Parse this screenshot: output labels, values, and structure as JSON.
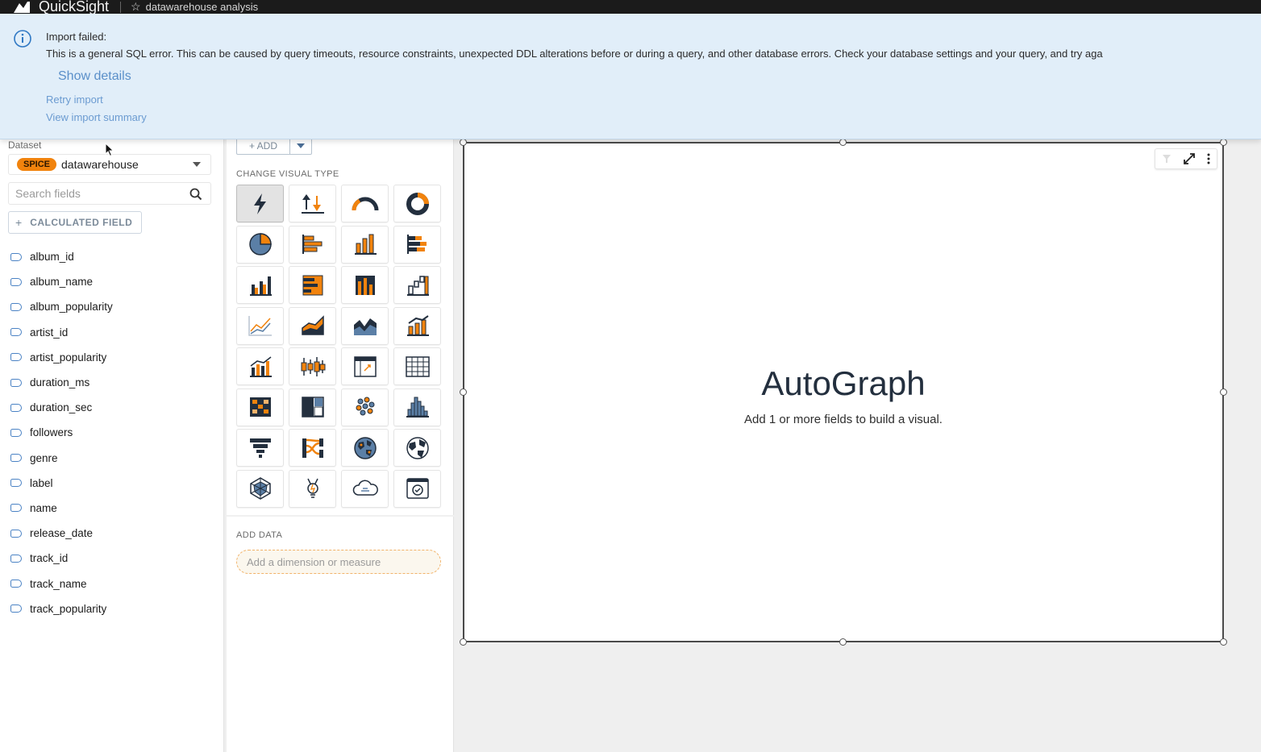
{
  "topbar": {
    "app_title": "QuickSight",
    "analysis_name": "datawarehouse analysis"
  },
  "banner": {
    "title": "Import failed:",
    "message": "This is a general SQL error. This can be caused by query timeouts, resource constraints, unexpected DDL alterations before or during a query, and other database errors. Check your database settings and your query, and try aga",
    "show_details": "Show details",
    "retry_import": "Retry import",
    "view_import_summary": "View import summary"
  },
  "dataset": {
    "label": "Dataset",
    "badge": "SPICE",
    "name": "datawarehouse"
  },
  "search": {
    "placeholder": "Search fields"
  },
  "calculated_field": {
    "label": "CALCULATED FIELD"
  },
  "fields": [
    "album_id",
    "album_name",
    "album_popularity",
    "artist_id",
    "artist_popularity",
    "duration_ms",
    "duration_sec",
    "followers",
    "genre",
    "label",
    "name",
    "release_date",
    "track_id",
    "track_name",
    "track_popularity"
  ],
  "visual_panel": {
    "add_label": "+ ADD",
    "change_visual_type_label": "CHANGE VISUAL TYPE",
    "add_data_label": "ADD DATA",
    "drop_placeholder": "Add a dimension or measure"
  },
  "visual": {
    "title": "AutoGraph",
    "subtitle": "Add 1 or more fields to build a visual."
  },
  "colors": {
    "accent_orange": "#f1830d",
    "icon_blue": "#232f3e",
    "link_blue": "#6b9bd1",
    "banner_bg": "#e1eef9"
  }
}
